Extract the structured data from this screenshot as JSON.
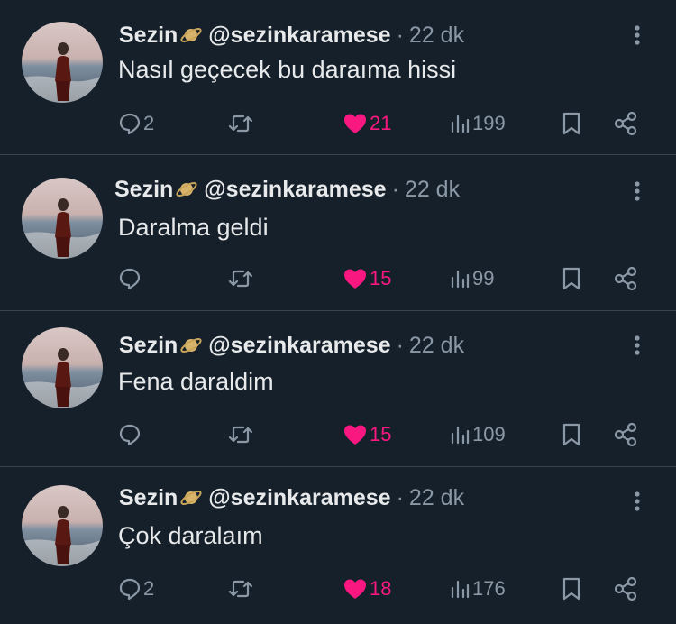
{
  "colors": {
    "background": "#15202b",
    "text": "#e7e9ea",
    "muted": "#8b98a5",
    "like_active": "#f91880",
    "divider": "#38444d"
  },
  "icons": {
    "reply": "speech-bubble-icon",
    "retweet": "retweet-arrows-icon",
    "like": "heart-filled-icon",
    "views": "bar-chart-icon",
    "bookmark": "bookmark-icon",
    "share": "share-nodes-icon",
    "more": "vertical-dots-icon",
    "badge": "saturn-planet-icon"
  },
  "tweets": [
    {
      "name": "Sezin",
      "handle": "@sezinkaramese",
      "separator": "·",
      "time": "22 dk",
      "text": "Nasıl geçecek bu daraıma hissi",
      "replies": "2",
      "retweets": "",
      "likes": "21",
      "views": "199"
    },
    {
      "name": "Sezin",
      "handle": "@sezinkaramese",
      "separator": "·",
      "time": "22 dk",
      "text": "Daralma geldi",
      "replies": "",
      "retweets": "",
      "likes": "15",
      "views": "99"
    },
    {
      "name": "Sezin",
      "handle": "@sezinkaramese",
      "separator": "·",
      "time": "22 dk",
      "text": "Fena daraldim",
      "replies": "",
      "retweets": "",
      "likes": "15",
      "views": "109"
    },
    {
      "name": "Sezin",
      "handle": "@sezinkaramese",
      "separator": "·",
      "time": "22 dk",
      "text": "Çok daralaım",
      "replies": "2",
      "retweets": "",
      "likes": "18",
      "views": "176"
    }
  ]
}
